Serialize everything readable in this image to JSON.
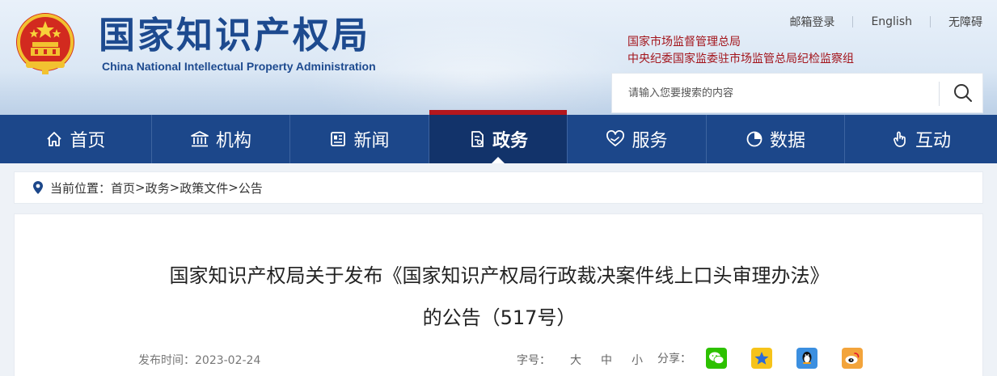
{
  "header": {
    "title": "国家知识产权局",
    "subtitle": "China National Intellectual Property Administration",
    "top_links": [
      "邮箱登录",
      "English",
      "无障碍"
    ],
    "org_line1": "国家市场监督管理总局",
    "org_line2": "中央纪委国家监委驻市场监管总局纪检监察组",
    "search_placeholder": "请输入您要搜索的内容"
  },
  "nav": {
    "items": [
      {
        "label": "首页",
        "icon": "home-icon"
      },
      {
        "label": "机构",
        "icon": "institution-icon"
      },
      {
        "label": "新闻",
        "icon": "news-icon"
      },
      {
        "label": "政务",
        "icon": "government-affairs-icon",
        "active": true
      },
      {
        "label": "服务",
        "icon": "service-icon"
      },
      {
        "label": "数据",
        "icon": "data-pie-icon"
      },
      {
        "label": "互动",
        "icon": "interaction-hand-icon"
      }
    ],
    "active_color": "#b3171d",
    "bar_color": "#1c478a"
  },
  "breadcrumb": {
    "prefix": "当前位置：",
    "items": [
      "首页",
      "政务",
      "政策文件",
      "公告"
    ],
    "separator": ">"
  },
  "article": {
    "title_line1": "国家知识产权局关于发布《国家知识产权局行政裁决案件线上口头审理办法》",
    "title_line2": "的公告（517号）",
    "publish_label": "发布时间：",
    "publish_date": "2023-02-24",
    "font_size_label": "字号：",
    "font_sizes": [
      "大",
      "中",
      "小"
    ],
    "share_label": "分享：",
    "share_icons": [
      "wechat-icon",
      "qzone-star-icon",
      "qq-penguin-icon",
      "weibo-icon"
    ]
  }
}
